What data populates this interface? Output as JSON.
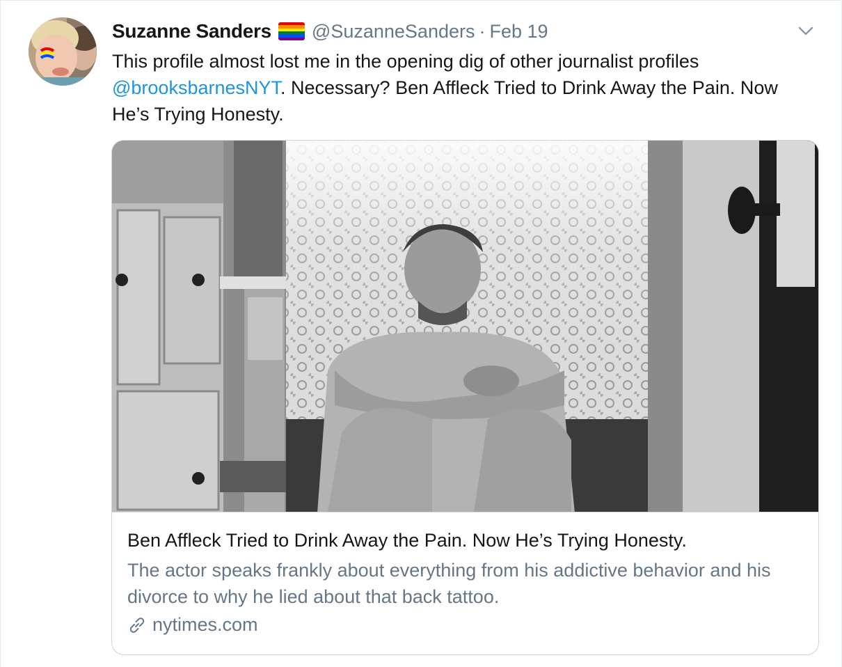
{
  "tweet": {
    "display_name": "Suzanne Sanders",
    "handle": "@SuzanneSanders",
    "separator": "·",
    "date": "Feb 19",
    "flag_colors": [
      "#e40303",
      "#ff8c00",
      "#ffed00",
      "#008026",
      "#004dff",
      "#750787"
    ],
    "text_before": "This profile almost lost me in the opening dig of other journalist profiles ",
    "mention": "@brooksbarnesNYT",
    "text_after": ". Necessary?  Ben Affleck Tried to Drink Away the Pain. Now He’s Trying Honesty."
  },
  "card": {
    "title": "Ben Affleck Tried to Drink Away the Pain. Now He’s Trying Honesty.",
    "description": "The actor speaks frankly about everything from his addictive behavior and his divorce to why he lied about that back tattoo.",
    "domain": "nytimes.com"
  },
  "icons": {
    "caret": "chevron-down-icon",
    "link": "link-icon",
    "flag": "rainbow-flag-icon"
  },
  "colors": {
    "link_blue": "#1b95e0",
    "secondary_text": "#657786",
    "border": "#ccd6dd"
  }
}
